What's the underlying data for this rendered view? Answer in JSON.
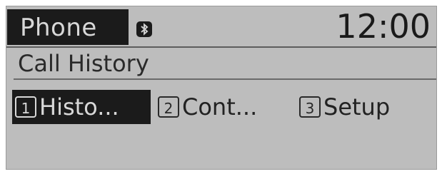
{
  "header": {
    "mode_title": "Phone",
    "clock": "12:00",
    "status_icon": "bluetooth-icon"
  },
  "screen": {
    "title": "Call History"
  },
  "menu": {
    "items": [
      {
        "number": "1",
        "label": "Histo...",
        "selected": true
      },
      {
        "number": "2",
        "label": "Cont...",
        "selected": false
      },
      {
        "number": "3",
        "label": "Setup",
        "selected": false
      }
    ]
  },
  "colors": {
    "screen_background": "#bdbdbd",
    "highlight_background": "#1b1b1b",
    "highlight_text": "#d8d8d8",
    "text": "#222222"
  }
}
